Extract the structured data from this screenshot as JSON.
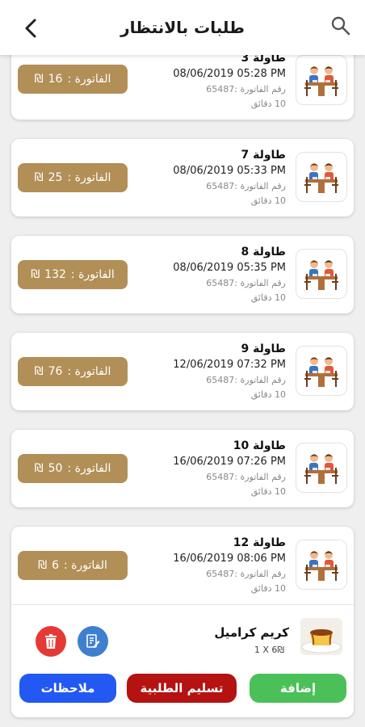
{
  "header": {
    "title": "طلبات بالانتظار"
  },
  "bill_prefix": "الفاتورة :",
  "currency": "₪",
  "orders": [
    {
      "table": "طاولة 3",
      "date": "08/06/2019 05:28 PM",
      "invoice": "رقم الفاتورة :65487",
      "minutes": "10 دقائق",
      "total": "16"
    },
    {
      "table": "طاولة 7",
      "date": "08/06/2019 05:33 PM",
      "invoice": "رقم الفاتورة :65487",
      "minutes": "10 دقائق",
      "total": "25"
    },
    {
      "table": "طاولة 8",
      "date": "08/06/2019 05:35 PM",
      "invoice": "رقم الفاتورة :65487",
      "minutes": "10 دقائق",
      "total": "132"
    },
    {
      "table": "طاولة 9",
      "date": "12/06/2019 07:32 PM",
      "invoice": "رقم الفاتورة :65487",
      "minutes": "10 دقائق",
      "total": "76"
    },
    {
      "table": "طاولة 10",
      "date": "16/06/2019 07:26 PM",
      "invoice": "رقم الفاتورة :65487",
      "minutes": "10 دقائق",
      "total": "50"
    },
    {
      "table": "طاولة 12",
      "date": "16/06/2019 08:06 PM",
      "invoice": "رقم الفاتورة :65487",
      "minutes": "10 دقائق",
      "total": "6"
    }
  ],
  "expanded_item": {
    "name": "كريم كراميل",
    "qty": "1 X 6₪"
  },
  "actions": {
    "add": "إضافة",
    "deliver": "تسليم الطلبية",
    "notes": "ملاحظات"
  },
  "colors": {
    "bill": "#b18f56",
    "add": "#4cc058",
    "deliver": "#b51212",
    "notes": "#2359f2",
    "delete": "#e53935",
    "edit": "#3f7fd0"
  }
}
